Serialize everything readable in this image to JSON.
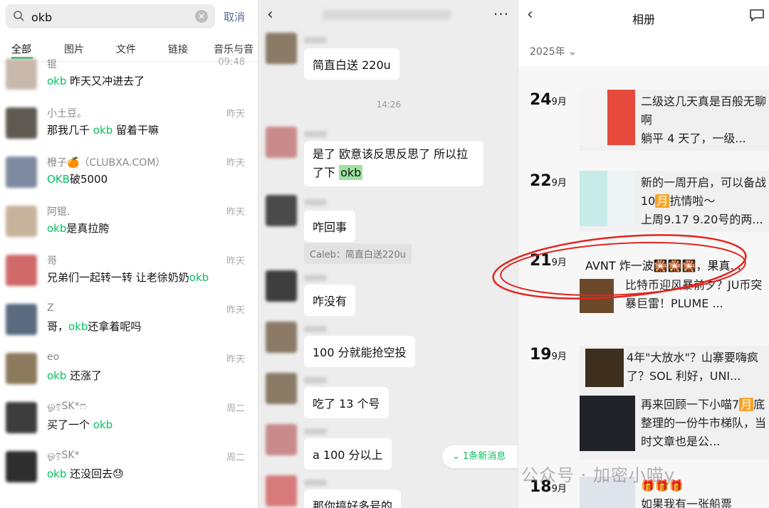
{
  "search": {
    "query": "okb",
    "cancel": "取消",
    "clear_icon": "clear-icon"
  },
  "tabs": [
    "全部",
    "图片",
    "文件",
    "链接",
    "音乐与音"
  ],
  "results": [
    {
      "name": "锟",
      "time": "09:48",
      "msg_pre": "",
      "msg_hl": "okb",
      "msg_post": " 昨天又冲进去了"
    },
    {
      "name": "小土豆。",
      "time": "昨天",
      "msg_pre": "那我几千 ",
      "msg_hl": "okb",
      "msg_post": " 留着干嘛"
    },
    {
      "name": "橙子🍊（CLUBXA.COM）",
      "time": "昨天",
      "msg_pre": "",
      "msg_hl": "OKB",
      "msg_post": "破5000"
    },
    {
      "name": "阿锟.",
      "time": "昨天",
      "msg_pre": "",
      "msg_hl": "okb",
      "msg_post": "是真拉胯"
    },
    {
      "name": "哥",
      "time": "昨天",
      "msg_pre": "兄弟们一起转一转 让老徐奶奶",
      "msg_hl": "okb",
      "msg_post": ""
    },
    {
      "name": "Z",
      "time": "昨天",
      "msg_pre": "哥，",
      "msg_hl": "okb",
      "msg_post": "还拿着呢吗"
    },
    {
      "name": "eo",
      "time": "昨天",
      "msg_pre": "",
      "msg_hl": "okb",
      "msg_post": " 还涨了"
    },
    {
      "name": "ஓඉSK*ෆ",
      "time": "周二",
      "msg_pre": "买了一个 ",
      "msg_hl": "okb",
      "msg_post": ""
    },
    {
      "name": "ஓඉSK*",
      "time": "周二",
      "msg_pre": "",
      "msg_hl": "okb",
      "msg_post": " 还没回去😓"
    }
  ],
  "chat": {
    "messages": [
      "简直白送 220u",
      "是了 欧意该反思反思了 所以拉了下 ",
      "咋回事",
      "咋没有",
      "100 分就能抢空投",
      "吃了 13 个号",
      "a  100 分以上",
      "那你搞好多号的"
    ],
    "okb_word": "okb",
    "timestamp": "14:26",
    "quote": "Caleb：简直白送220u",
    "new_msg": "1条新消息",
    "more_icon": "···"
  },
  "album": {
    "title": "相册",
    "year": "2025年",
    "entries": [
      {
        "day": "24",
        "month": "9月",
        "line1": "二级这几天真是百般无聊啊",
        "line2": "躺平 4 天了，一级..."
      },
      {
        "day": "22",
        "month": "9月",
        "line1a": "新的一周开启，可以备战10",
        "tag": "月",
        "line1b": "抗情啦～",
        "line2": "上周9.17 9.20号的两..."
      },
      {
        "day": "21",
        "month": "9月",
        "line1": "AVNT 炸一波🎇🎇🎇，果真...",
        "line2": "比特币迎风暴前夕？JU币突暴巨雷！PLUME ..."
      },
      {
        "day": "19",
        "month": "9月",
        "line1": "4年\"大放水\"？山寨要嗨疯了？SOL 利好，UNI...",
        "line2a": "再来回顾一下小喵7",
        "tag": "月",
        "line2b": "底整理的一份牛市梯队，当时文章也是公..."
      },
      {
        "day": "18",
        "month": "9月",
        "line1": "🎁🎁🎁",
        "line2": "如果我有一张船票"
      }
    ]
  },
  "watermark": "公众号 · 加密小喵y",
  "colors": {
    "accent": "#07c160",
    "link": "#576b95",
    "circle": "#e0261f"
  }
}
